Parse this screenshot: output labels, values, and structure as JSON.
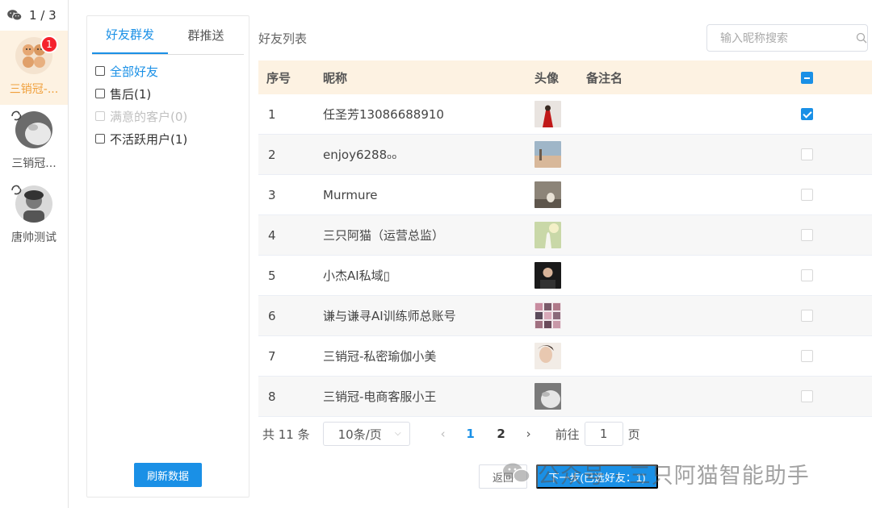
{
  "rail": {
    "page_indicator": "1 / 3",
    "accounts": [
      {
        "name": "三销冠-...",
        "badge": "1",
        "active": true
      },
      {
        "name": "三销冠...",
        "active": false
      },
      {
        "name": "唐帅测试",
        "active": false
      }
    ]
  },
  "groups": {
    "tabs": [
      {
        "label": "好友群发",
        "active": true
      },
      {
        "label": "群推送",
        "active": false
      }
    ],
    "items": [
      {
        "label": "全部好友",
        "state": "primary"
      },
      {
        "label": "售后(1)",
        "state": "normal"
      },
      {
        "label": "满意的客户(0)",
        "state": "disabled"
      },
      {
        "label": "不活跃用户(1)",
        "state": "normal"
      }
    ],
    "refresh_label": "刷新数据"
  },
  "friends": {
    "title": "好友列表",
    "search_placeholder": "输入昵称搜索",
    "columns": {
      "index": "序号",
      "nickname": "昵称",
      "avatar": "头像",
      "remark": "备注名"
    },
    "rows": [
      {
        "index": "1",
        "nickname": "任圣芳13086688910",
        "remark": "",
        "selected": true
      },
      {
        "index": "2",
        "nickname": "enjoy6288ₒₒ",
        "remark": "",
        "selected": false
      },
      {
        "index": "3",
        "nickname": "Murmure",
        "remark": "",
        "selected": false
      },
      {
        "index": "4",
        "nickname": "三只阿猫（运营总监）",
        "remark": "",
        "selected": false
      },
      {
        "index": "5",
        "nickname": "小杰AI私域▯",
        "remark": "",
        "selected": false
      },
      {
        "index": "6",
        "nickname": "谦与谦寻AI训练师总账号",
        "remark": "",
        "selected": false
      },
      {
        "index": "7",
        "nickname": "三销冠-私密瑜伽小美",
        "remark": "",
        "selected": false
      },
      {
        "index": "8",
        "nickname": "三销冠-电商客服小王",
        "remark": "",
        "selected": false
      }
    ]
  },
  "pager": {
    "total": "共 11 条",
    "page_size": "10条/页",
    "prev": "‹",
    "next": "›",
    "pages": [
      {
        "label": "1",
        "current": true
      },
      {
        "label": "2",
        "current": false
      }
    ],
    "goto_label": "前往",
    "goto_value": "1",
    "page_unit": "页"
  },
  "footer": {
    "back_label": "返回",
    "next_label": "下一步(已选好友：1)"
  },
  "watermark": {
    "text": "公众号 · 三只阿猫智能助手"
  }
}
